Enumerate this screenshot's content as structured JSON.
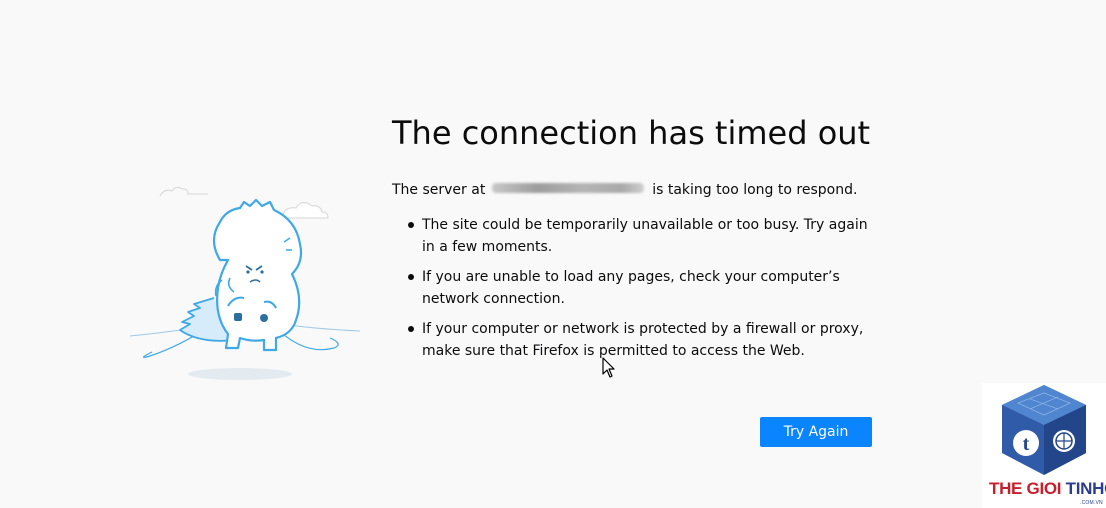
{
  "error": {
    "title": "The connection has timed out",
    "intro_prefix": "The server at",
    "intro_suffix": "is taking too long to respond.",
    "bullets": [
      "The site could be temporarily unavailable or too busy. Try again in a few moments.",
      "If you are unable to load any pages, check your computer’s network connection.",
      "If your computer or network is protected by a firewall or proxy, make sure that Firefox is permitted to access the Web."
    ],
    "try_again_label": "Try Again"
  },
  "watermark": {
    "brand_part1": "THE GIOI ",
    "brand_part2": "TINHOC",
    "domain_suffix": ".COM.VN"
  },
  "colors": {
    "background": "#f9f9fa",
    "button": "#0a84ff",
    "illustration": "#3fa8e6",
    "watermark_red": "#c7202d",
    "watermark_blue": "#2a3d8f"
  },
  "icons": [
    "dinosaur-illustration",
    "cloud-icon",
    "mouse-cursor-icon",
    "brand-logo-icon"
  ]
}
